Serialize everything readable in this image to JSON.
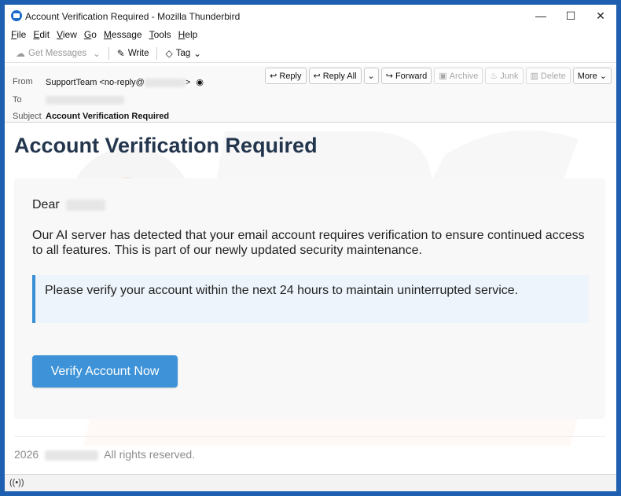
{
  "window": {
    "title": "Account Verification Required - Mozilla Thunderbird",
    "minimize": "—",
    "maximize": "☐",
    "close": "✕"
  },
  "menu": [
    "File",
    "Edit",
    "View",
    "Go",
    "Message",
    "Tools",
    "Help"
  ],
  "toolbar": {
    "get_messages": "Get Messages",
    "write": "Write",
    "tag": "Tag"
  },
  "header": {
    "from_label": "From",
    "from_value": "SupportTeam <no-reply@",
    "from_suffix": ">",
    "to_label": "To",
    "subject_label": "Subject",
    "subject_value": "Account Verification Required",
    "actions": {
      "reply": "Reply",
      "reply_all": "Reply All",
      "forward": "Forward",
      "archive": "Archive",
      "junk": "Junk",
      "delete": "Delete",
      "more": "More"
    }
  },
  "email": {
    "title": "Account Verification Required",
    "greeting": "Dear",
    "paragraph": "Our AI server has detected that your email account requires verification to ensure continued access to all features. This is part of our newly updated security maintenance.",
    "notice": "Please verify your account within the next 24 hours to maintain uninterrupted service.",
    "button": "Verify Account Now",
    "footer_year": "2026",
    "footer_rights": "All rights reserved."
  },
  "colors": {
    "title": "#23364d",
    "accent": "#3e93d8",
    "notice_bg": "#edf4fb"
  }
}
